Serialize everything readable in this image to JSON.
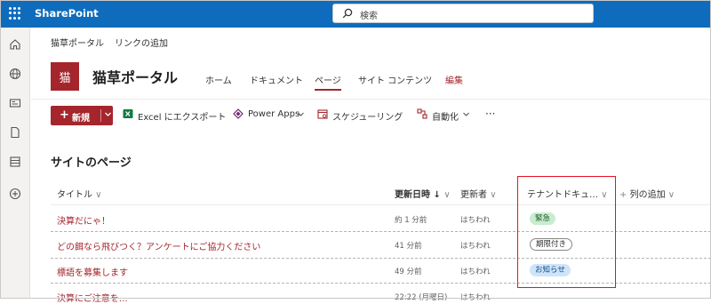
{
  "suite_bar": {
    "app_name": "SharePoint",
    "search_placeholder": "検索",
    "waffle_icon": "app-launcher-icon",
    "bg_color": "#0f6cbd"
  },
  "left_rail": {
    "icons": [
      "home-icon",
      "globe-icon",
      "news-icon",
      "file-icon",
      "database-icon",
      "add-circle-icon"
    ]
  },
  "breadcrumb": [
    "猫草ポータル",
    "リンクの追加"
  ],
  "site": {
    "logo_text": "猫",
    "title": "猫草ポータル",
    "accent_color": "#a4262c",
    "nav": [
      "ホーム",
      "ドキュメント",
      "ページ",
      "サイト コンテンツ",
      "編集"
    ],
    "active_nav": "ページ"
  },
  "command_bar": {
    "new_label": "新規",
    "excel_label": "Excel にエクスポート",
    "powerapps_label": "Power Apps",
    "schedule_label": "スケジューリング",
    "automate_label": "自動化",
    "more": "···"
  },
  "list": {
    "heading": "サイトのページ",
    "columns": {
      "title": "タイトル",
      "modified": "更新日時",
      "modified_sort": "↓",
      "modified_by": "更新者",
      "tenant": "テナントドキュ…",
      "add_column": "列の追加"
    },
    "rows": [
      {
        "title": "決算だにゃ！",
        "modified": "約 1 分前",
        "modified_by": "はちわれ",
        "tag": "緊急"
      },
      {
        "title": "どの餌なら飛びつく？アンケートにご協力ください",
        "modified": "41 分前",
        "modified_by": "はちわれ",
        "tag": "期限付き"
      },
      {
        "title": "標語を募集します",
        "modified": "49 分前",
        "modified_by": "はちわれ",
        "tag": "お知らせ"
      },
      {
        "title": "決算にご注意を…",
        "modified": "22:22 (月曜日)",
        "modified_by": "はちわれ",
        "tag": ""
      }
    ]
  }
}
